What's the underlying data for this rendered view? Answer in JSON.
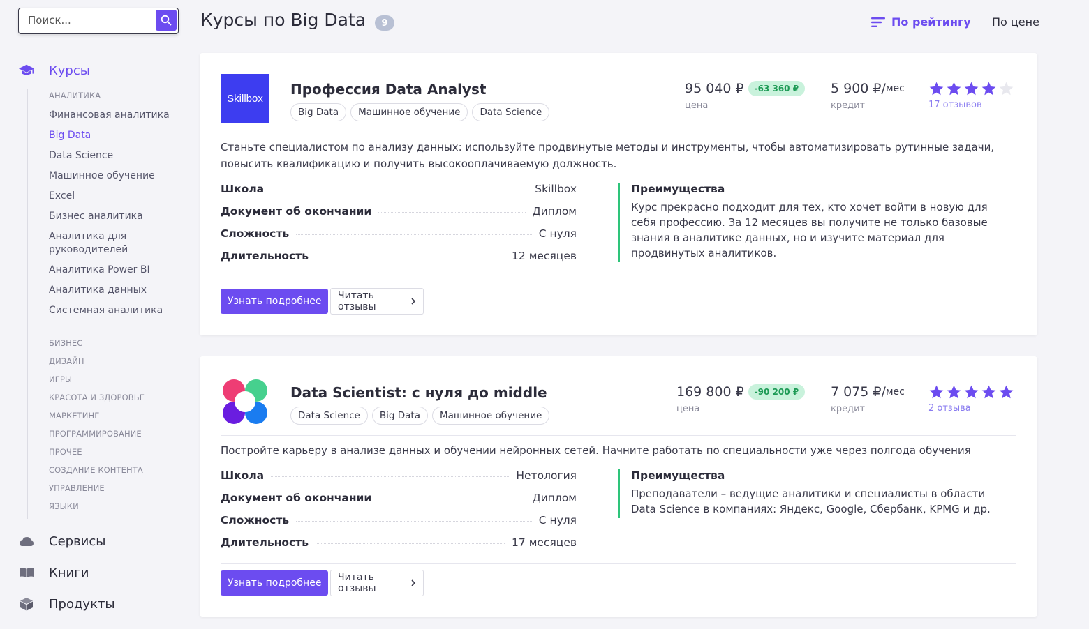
{
  "search": {
    "placeholder": "Поиск..."
  },
  "sidebar": {
    "courses_label": "Курсы",
    "subcategories_header": "АНАЛИТИКА",
    "subcategories": [
      "Финансовая аналитика",
      "Big Data",
      "Data Science",
      "Машинное обучение",
      "Excel",
      "Бизнес аналитика",
      "Аналитика для руководителей",
      "Аналитика Power BI",
      "Аналитика данных",
      "Системная аналитика"
    ],
    "active_subcategory": "Big Data",
    "categories": [
      "БИЗНЕС",
      "ДИЗАЙН",
      "ИГРЫ",
      "КРАСОТА И ЗДОРОВЬЕ",
      "МАРКЕТИНГ",
      "ПРОГРАММИРОВАНИЕ",
      "ПРОЧЕЕ",
      "СОЗДАНИЕ КОНТЕНТА",
      "УПРАВЛЕНИЕ",
      "ЯЗЫКИ"
    ],
    "services_label": "Сервисы",
    "books_label": "Книги",
    "products_label": "Продукты"
  },
  "header": {
    "title": "Курсы по Big Data",
    "count": "9",
    "sort_rating": "По рейтингу",
    "sort_price": "По цене"
  },
  "labels": {
    "price": "цена",
    "credit": "кредит",
    "per_month": "мес",
    "school": "Школа",
    "document": "Документ об окончании",
    "difficulty": "Сложность",
    "duration": "Длительность",
    "advantages": "Преимущества",
    "more_button": "Узнать подробнее",
    "reviews_button": "Читать отзывы"
  },
  "courses": [
    {
      "logo_text": "Skillbox",
      "title": "Профессия Data Analyst",
      "tags": [
        "Big Data",
        "Машинное обучение",
        "Data Science"
      ],
      "price": "95 040 ₽",
      "discount": "-63 360 ₽",
      "credit": "5 900 ₽/",
      "rating": 4,
      "reviews": "17 отзывов",
      "description": "Станьте специалистом по анализу данных: используйте продвинутые методы и инструменты, чтобы автоматизировать рутинные задачи, повысить квалификацию и получить высокооплачиваемую должность.",
      "school": "Skillbox",
      "document": "Диплом",
      "difficulty": "С нуля",
      "duration": "12 месяцев",
      "advantages": "Курс прекрасно подходит для тех, кто хочет войти в новую для себя профессию. За 12 месяцев вы получите не только базовые знания в аналитике данных, но и изучите материал для продвинутых аналитиков."
    },
    {
      "logo_text": "",
      "title": "Data Scientist: с нуля до middle",
      "tags": [
        "Data Science",
        "Big Data",
        "Машинное обучение"
      ],
      "price": "169 800 ₽",
      "discount": "-90 200 ₽",
      "credit": "7 075 ₽/",
      "rating": 5,
      "reviews": "2 отзыва",
      "description": "Постройте карьеру в анализе данных и обучении нейронных сетей. Начните работать по специальности уже через полгода обучения",
      "school": "Нетология",
      "document": "Диплом",
      "difficulty": "С нуля",
      "duration": "17 месяцев",
      "advantages": "Преподаватели – ведущие аналитики и специалисты в области Data Science в компаниях: Яндекс, Google, Сбербанк, KPMG и др."
    }
  ],
  "colors": {
    "accent": "#6c4cf0",
    "discount_bg": "#c9f2dc",
    "discount_text": "#1d9a55",
    "advantage_border": "#2ec47a",
    "skillbox_logo": "#3d3df0"
  }
}
